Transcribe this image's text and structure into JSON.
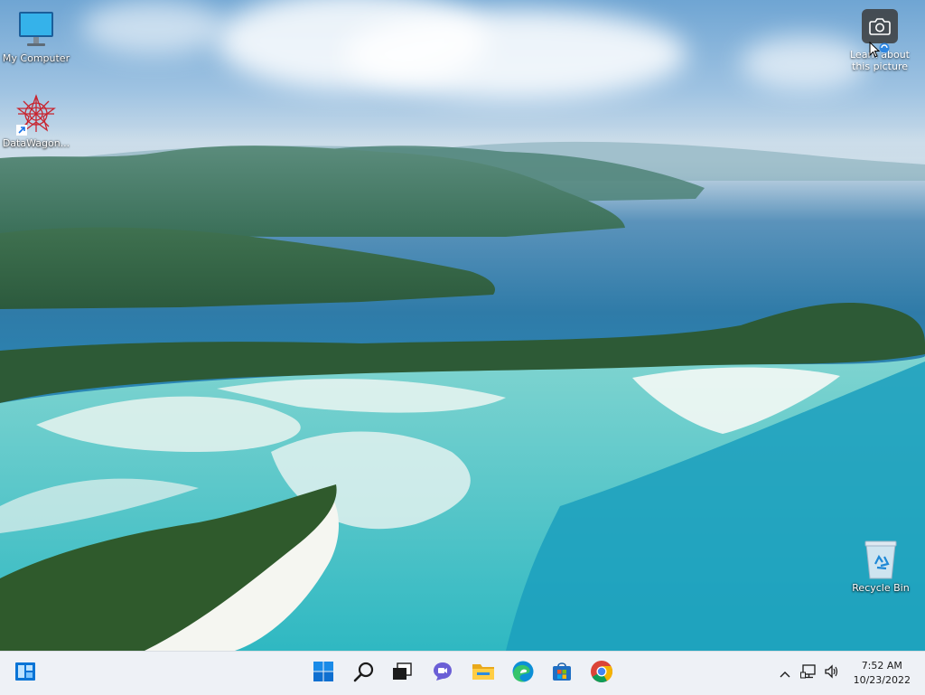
{
  "desktop": {
    "icons": [
      {
        "label": "My Computer",
        "icon": "monitor-icon"
      },
      {
        "label": "DataWagon...",
        "icon": "datawagon-shortcut-icon"
      },
      {
        "label": "Recycle Bin",
        "icon": "recycle-bin-icon"
      }
    ],
    "learn_about_picture": {
      "label_line1": "Learn about",
      "label_line2": "this picture",
      "icon": "camera-icon"
    }
  },
  "taskbar": {
    "left_widget": "widgets-icon",
    "pinned": [
      {
        "name": "start-button",
        "icon": "windows-logo-icon"
      },
      {
        "name": "search-button",
        "icon": "search-icon"
      },
      {
        "name": "task-view-button",
        "icon": "task-view-icon"
      },
      {
        "name": "chat-button",
        "icon": "chat-icon"
      },
      {
        "name": "file-explorer-button",
        "icon": "folder-icon"
      },
      {
        "name": "edge-button",
        "icon": "edge-icon"
      },
      {
        "name": "store-button",
        "icon": "store-icon"
      },
      {
        "name": "chrome-button",
        "icon": "chrome-icon"
      }
    ],
    "tray": {
      "icons": [
        "chevron-up-icon",
        "network-icon",
        "volume-icon"
      ],
      "time": "7:52 AM",
      "date": "10/23/2022"
    }
  },
  "colors": {
    "taskbar_bg": "#eef1f6",
    "windows_blue": "#0a74d6"
  }
}
